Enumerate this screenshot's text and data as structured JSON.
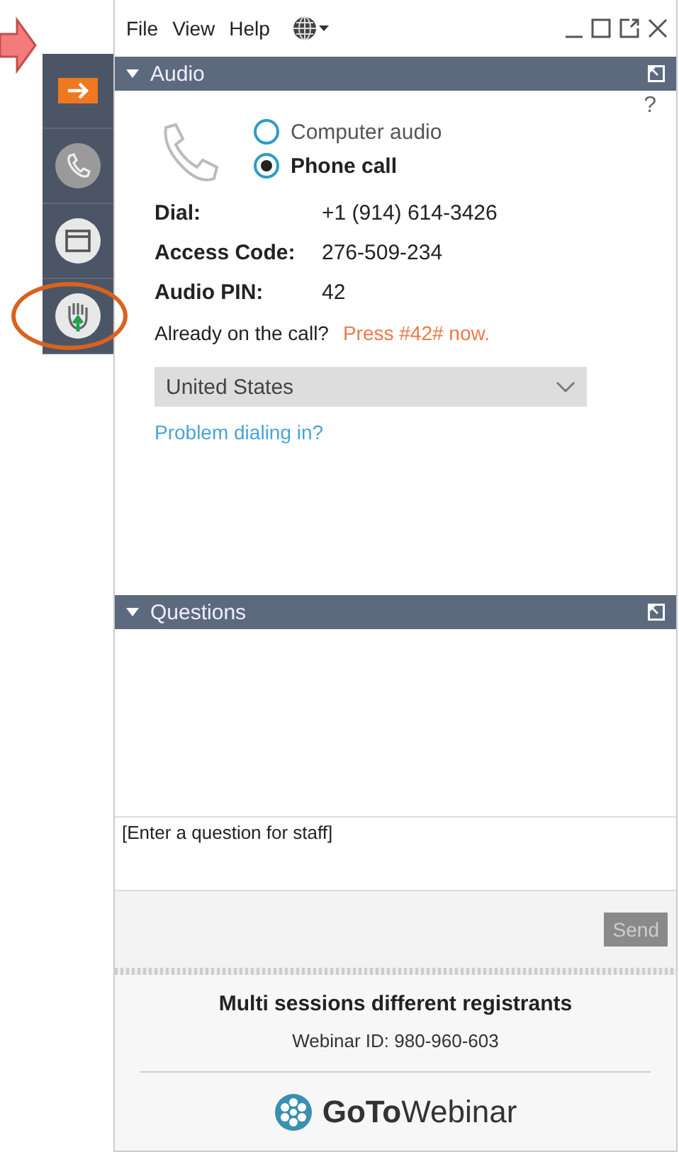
{
  "menu": [
    {
      "label": "File"
    },
    {
      "label": "View"
    },
    {
      "label": "Help"
    }
  ],
  "sidebar": {
    "items": [
      {
        "kind": "arrow",
        "highlighted": false
      },
      {
        "kind": "phone",
        "highlighted": false
      },
      {
        "kind": "window",
        "highlighted": false
      },
      {
        "kind": "hand",
        "highlighted": true
      }
    ]
  },
  "audio": {
    "title": "Audio",
    "help": "?",
    "options": [
      {
        "label": "Computer audio",
        "selected": false
      },
      {
        "label": "Phone call",
        "selected": true
      }
    ],
    "details": [
      {
        "label": "Dial:",
        "value": "+1 (914) 614-3426"
      },
      {
        "label": "Access Code:",
        "value": "276-509-234"
      },
      {
        "label": "Audio PIN:",
        "value": "42"
      }
    ],
    "already": "Already on the call?",
    "press": "Press #42# now.",
    "country": "United States",
    "problem_link": "Problem dialing in?"
  },
  "questions": {
    "title": "Questions",
    "placeholder": "[Enter a question for staff]",
    "send": {
      "label": "Send",
      "disabled": true
    }
  },
  "footer": {
    "title": "Multi sessions different registrants",
    "webinar_id": "Webinar ID: 980-960-603",
    "logo": "**GoTo**Webinar"
  }
}
